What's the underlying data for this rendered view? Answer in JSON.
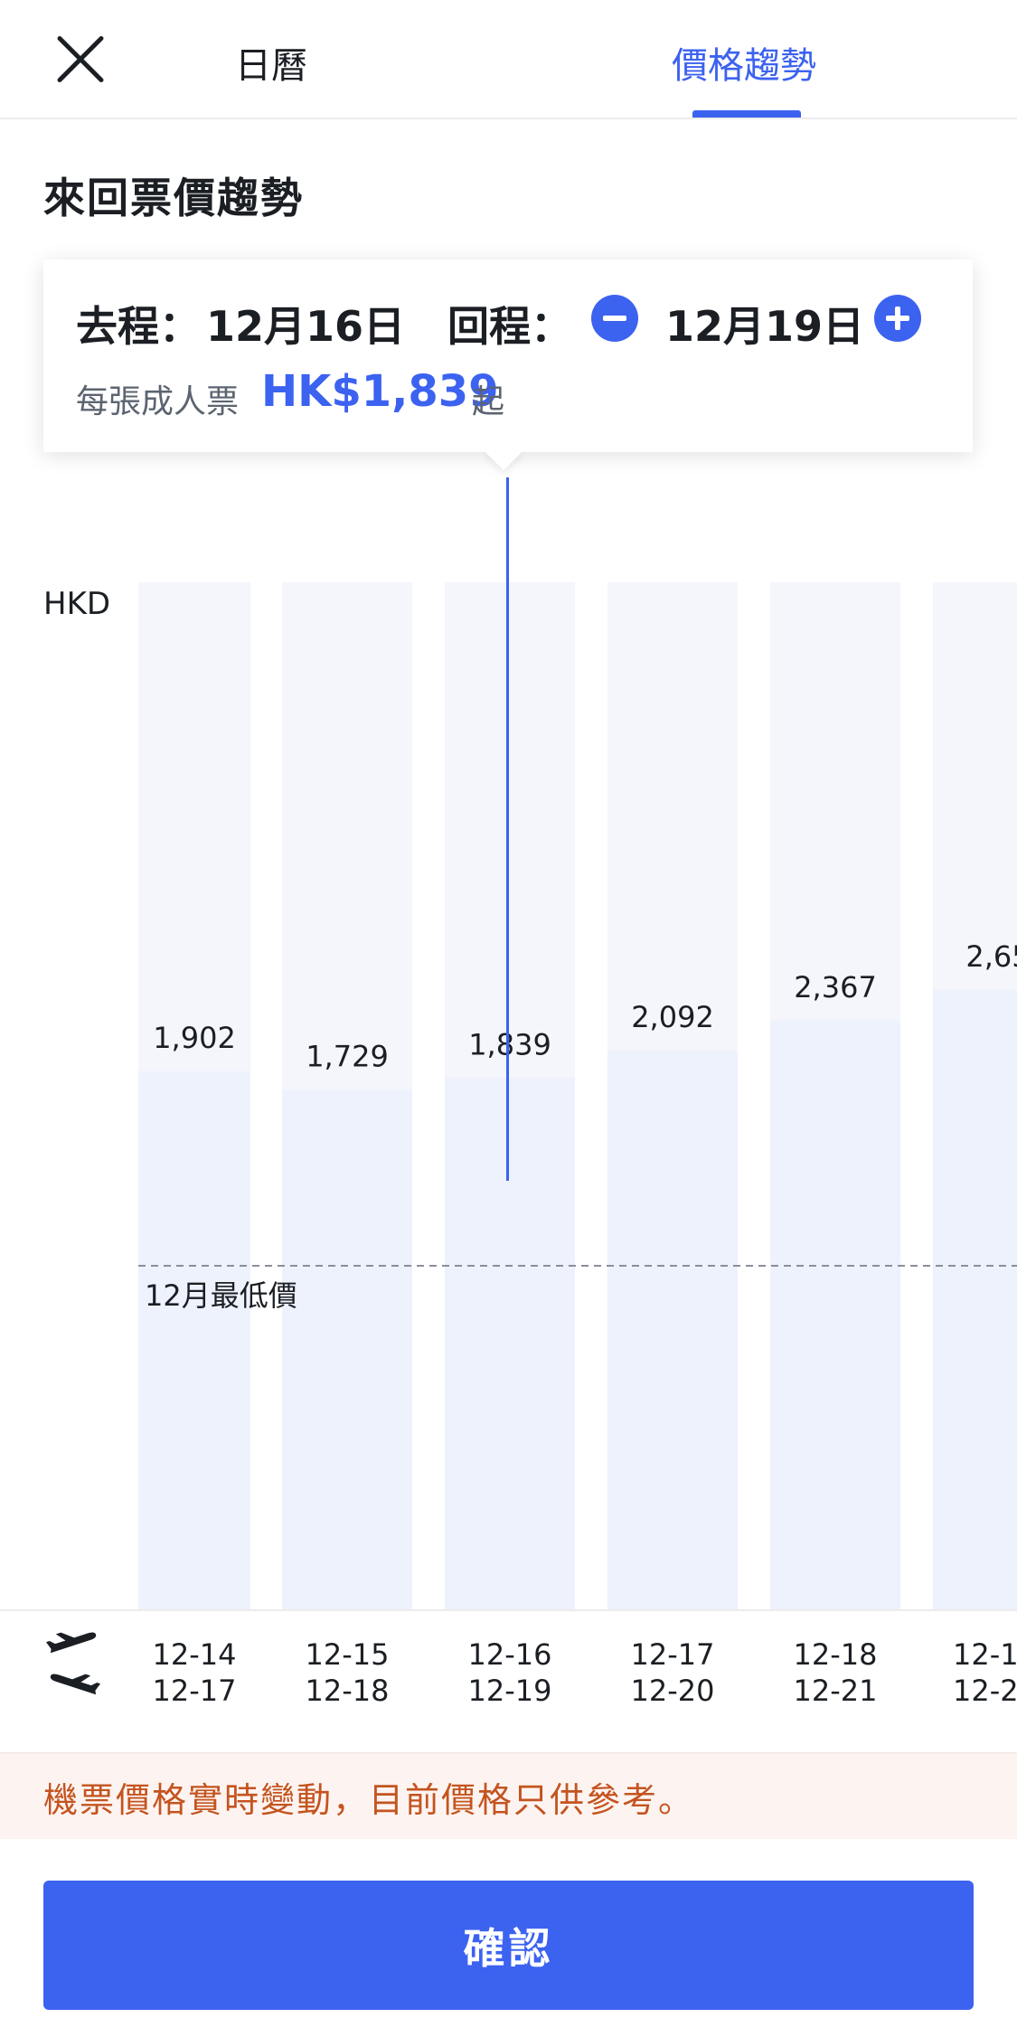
{
  "header": {
    "close_icon": "close-icon",
    "tabs": [
      {
        "label": "日曆",
        "active": false
      },
      {
        "label": "價格趨勢",
        "active": true
      }
    ]
  },
  "section_title": "來回票價趨勢",
  "selection": {
    "outbound_label": "去程：",
    "outbound_date": "12月16日",
    "return_label": "回程：",
    "return_date": "12月19日",
    "minus_icon": "minus-icon",
    "plus_icon": "plus-icon",
    "price_prefix": "每張成人票",
    "price_value": "HK$1,839",
    "price_suffix": "起"
  },
  "chart_data": {
    "type": "bar",
    "unit_label": "HKD",
    "categories": [
      {
        "depart": "12-14",
        "return": "12-17"
      },
      {
        "depart": "12-15",
        "return": "12-18"
      },
      {
        "depart": "12-16",
        "return": "12-19"
      },
      {
        "depart": "12-17",
        "return": "12-20"
      },
      {
        "depart": "12-18",
        "return": "12-21"
      },
      {
        "depart": "12-1",
        "return": "12-2"
      }
    ],
    "values": [
      1902,
      1729,
      1839,
      2092,
      2367,
      2650
    ],
    "value_labels": [
      "1,902",
      "1,729",
      "1,839",
      "2,092",
      "2,367",
      "2,65"
    ],
    "selected_index": 2,
    "reference_line": {
      "label": "12月最低價"
    },
    "colors": {
      "bar": "#eef2fd",
      "bar_track": "#f4f6fc",
      "accent": "#3c62f0"
    }
  },
  "axis_icons": {
    "depart": "plane-depart-icon",
    "return": "plane-return-icon"
  },
  "notice": "機票價格實時變動，目前價格只供參考。",
  "confirm_label": "確認"
}
